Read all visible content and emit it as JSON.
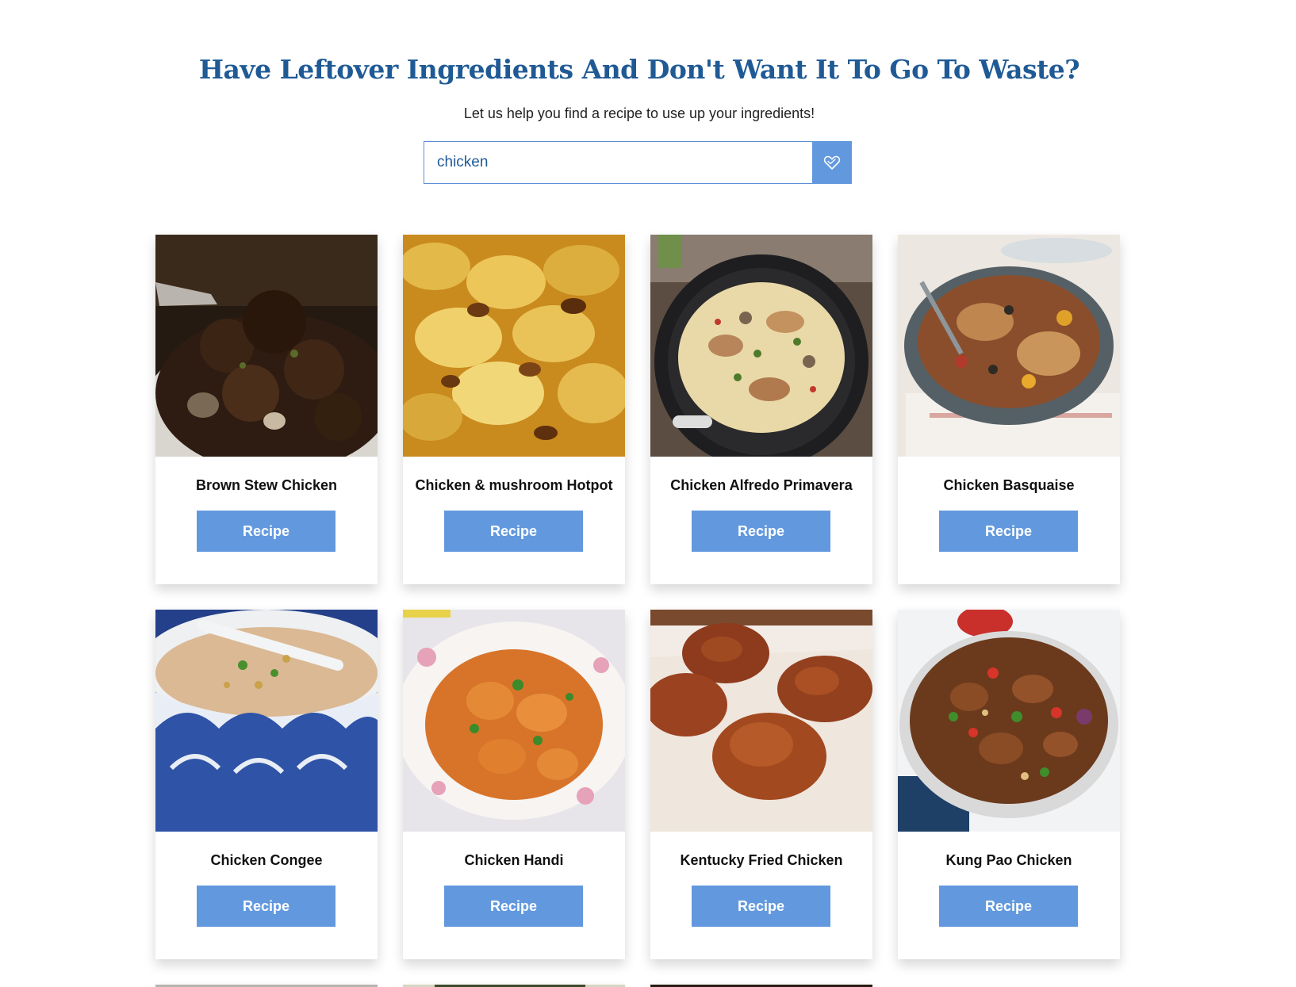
{
  "header": {
    "headline": "Have Leftover Ingredients And Don't Want It To Go To Waste?",
    "subtitle": "Let us help you find a recipe to use up your ingredients!"
  },
  "search": {
    "value": "chicken",
    "button_icon": "heart-icon"
  },
  "recipe_button_label": "Recipe",
  "recipes": [
    {
      "title": "Brown Stew Chicken",
      "image": "brown stew chicken in a bowl"
    },
    {
      "title": "Chicken & mushroom Hotpot",
      "image": "potato-topped hotpot"
    },
    {
      "title": "Chicken Alfredo Primavera",
      "image": "pasta in a black pan"
    },
    {
      "title": "Chicken Basquaise",
      "image": "chicken in a grey casserole"
    },
    {
      "title": "Chicken Congee",
      "image": "congee in a blue patterned bowl"
    },
    {
      "title": "Chicken Handi",
      "image": "orange chicken curry in a floral bowl"
    },
    {
      "title": "Kentucky Fried Chicken",
      "image": "fried chicken on a plate"
    },
    {
      "title": "Kung Pao Chicken",
      "image": "kung pao chicken in a white bowl"
    }
  ],
  "colors": {
    "headline": "#1f5a95",
    "accent": "#6299de",
    "input_border": "#5c8fd8"
  }
}
